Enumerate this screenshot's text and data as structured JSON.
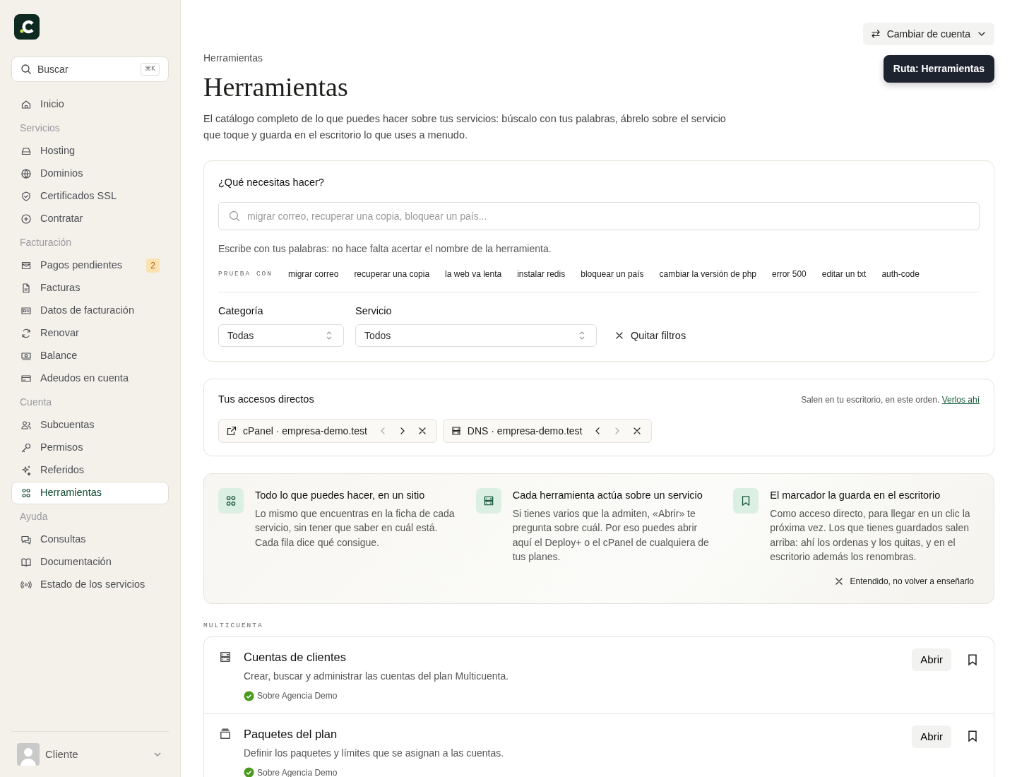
{
  "sidebar": {
    "search": {
      "placeholder": "Buscar",
      "shortcut": "⌘K"
    },
    "items": [
      {
        "kind": "link",
        "label": "Inicio",
        "selected": false
      },
      {
        "kind": "section",
        "label": "Servicios"
      },
      {
        "kind": "link",
        "label": "Hosting",
        "selected": false
      },
      {
        "kind": "link",
        "label": "Dominios",
        "selected": false
      },
      {
        "kind": "link",
        "label": "Certificados SSL",
        "selected": false
      },
      {
        "kind": "link",
        "label": "Contratar",
        "selected": false
      },
      {
        "kind": "section",
        "label": "Facturación"
      },
      {
        "kind": "link",
        "label": "Pagos pendientes",
        "selected": false,
        "badge": "2"
      },
      {
        "kind": "link",
        "label": "Facturas",
        "selected": false
      },
      {
        "kind": "link",
        "label": "Datos de facturación",
        "selected": false
      },
      {
        "kind": "link",
        "label": "Renovar",
        "selected": false
      },
      {
        "kind": "link",
        "label": "Balance",
        "selected": false
      },
      {
        "kind": "link",
        "label": "Adeudos en cuenta",
        "selected": false
      },
      {
        "kind": "section",
        "label": "Cuenta"
      },
      {
        "kind": "link",
        "label": "Subcuentas",
        "selected": false
      },
      {
        "kind": "link",
        "label": "Permisos",
        "selected": false
      },
      {
        "kind": "link",
        "label": "Referidos",
        "selected": false
      },
      {
        "kind": "link",
        "label": "Herramientas",
        "selected": true
      },
      {
        "kind": "section",
        "label": "Ayuda"
      },
      {
        "kind": "link",
        "label": "Consultas",
        "selected": false
      },
      {
        "kind": "link",
        "label": "Documentación",
        "selected": false
      },
      {
        "kind": "link",
        "label": "Estado de los servicios",
        "selected": false
      }
    ],
    "user": {
      "name": "Cliente"
    }
  },
  "topbar": {
    "account_button": "Cambiar de cuenta",
    "tooltip": "Ruta: Herramientas"
  },
  "breadcrumb": "Herramientas",
  "title": "Herramientas",
  "intro": "El catálogo completo de lo que puedes hacer sobre tus servicios: búscalo con tus palabras, ábrelo sobre el servicio que toque y guarda en el escritorio lo que uses a menudo.",
  "finder": {
    "label": "¿Qué necesitas hacer?",
    "placeholder": "migrar correo, recuperar una copia, bloquear un país...",
    "hint": "Escribe con tus palabras: no hace falta acertar el nombre de la herramienta.",
    "suggestions_label": "PRUEBA CON",
    "suggestions": [
      "migrar correo",
      "recuperar una copia",
      "la web va lenta",
      "instalar redis",
      "bloquear un país",
      "cambiar la versión de php",
      "error 500",
      "editar un txt",
      "auth-code"
    ],
    "filters": [
      {
        "label": "Categoría",
        "value": "Todas"
      },
      {
        "label": "Servicio",
        "value": "Todos"
      }
    ],
    "clear": "Quitar filtros"
  },
  "shortcuts": {
    "title": "Tus accesos directos",
    "note": "Salen en tu escritorio, en este orden.",
    "note_link": "Verlos ahí",
    "items": [
      {
        "label": "cPanel · empresa-demo.test",
        "prev_disabled": true,
        "next_disabled": false
      },
      {
        "label": "DNS · empresa-demo.test",
        "prev_disabled": false,
        "next_disabled": true
      }
    ]
  },
  "tips": {
    "items": [
      {
        "title": "Todo lo que puedes hacer, en un sitio",
        "text": "Lo mismo que encuentras en la ficha de cada servicio, sin tener que saber en cuál está. Cada fila dice qué consigue."
      },
      {
        "title": "Cada herramienta actúa sobre un servicio",
        "text": "Si tienes varios que la admiten, «Abrir» te pregunta sobre cuál. Por eso puedes abrir aquí el Deploy+ o el cPanel de cualquiera de tus planes."
      },
      {
        "title": "El marcador la guarda en el escritorio",
        "text": "Como acceso directo, para llegar en un clic la próxima vez. Los que tienes guardados salen arriba: ahí los ordenas y los quitas, y en el escritorio además los renombras."
      }
    ],
    "dismiss": "Entendido, no volver a enseñarlo"
  },
  "group": {
    "title": "MULTICUENTA",
    "tools": [
      {
        "name": "Cuentas de clientes",
        "description": "Crear, buscar y administrar las cuentas del plan Multicuenta.",
        "scope": "Sobre Agencia Demo",
        "action": "Abrir",
        "bookmarked": false
      },
      {
        "name": "Paquetes del plan",
        "description": "Definir los paquetes y límites que se asignan a las cuentas.",
        "scope": "Sobre Agencia Demo",
        "action": "Abrir",
        "bookmarked": false
      }
    ]
  }
}
